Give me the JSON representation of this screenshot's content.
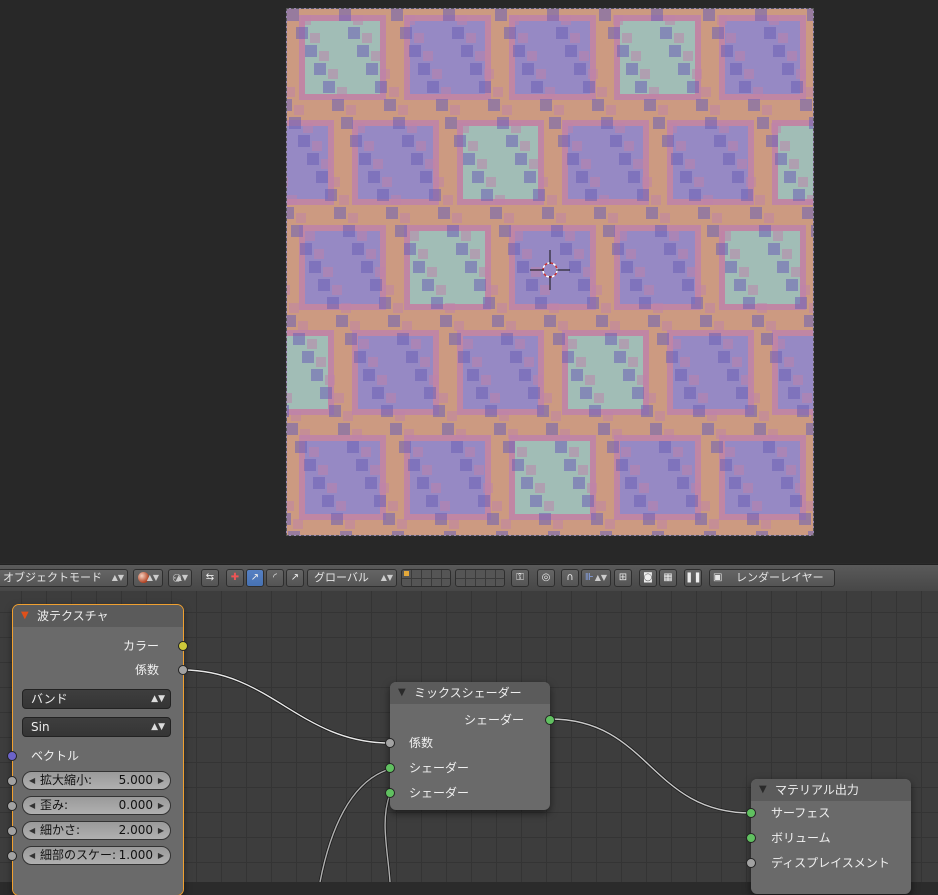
{
  "viewport": {
    "render_label": "rendered wave texture material",
    "pattern_colors": [
      "#8b84c8",
      "#9ad0b4",
      "#d89a6a",
      "#c57aa0",
      "#5a4fae"
    ]
  },
  "header": {
    "mode_label": "オブジェクトモード",
    "orientation_label": "グローバル",
    "render_layer_label": "レンダーレイヤー"
  },
  "nodes": {
    "wave_texture": {
      "title": "波テクスチャ",
      "outputs": [
        "カラー",
        "係数"
      ],
      "type_value": "バンド",
      "profile_value": "Sin",
      "vector_label": "ベクトル",
      "fields": [
        {
          "label": "拡大縮小:",
          "value": "5.000"
        },
        {
          "label": "歪み:",
          "value": "0.000"
        },
        {
          "label": "細かさ:",
          "value": "2.000"
        },
        {
          "label": "細部のスケー:",
          "value": "1.000"
        }
      ]
    },
    "mix_shader": {
      "title": "ミックスシェーダー",
      "output": "シェーダー",
      "inputs": [
        "係数",
        "シェーダー",
        "シェーダー"
      ]
    },
    "material_output": {
      "title": "マテリアル出力",
      "inputs": [
        "サーフェス",
        "ボリューム",
        "ディスプレイスメント"
      ]
    }
  },
  "colors": {
    "selected_outline": "#f0a030",
    "socket_yellow": "#cdc83a",
    "socket_grey": "#a2a2a2",
    "socket_green": "#60c060",
    "socket_purple": "#6c63c8",
    "active_button": "#5680c2"
  }
}
